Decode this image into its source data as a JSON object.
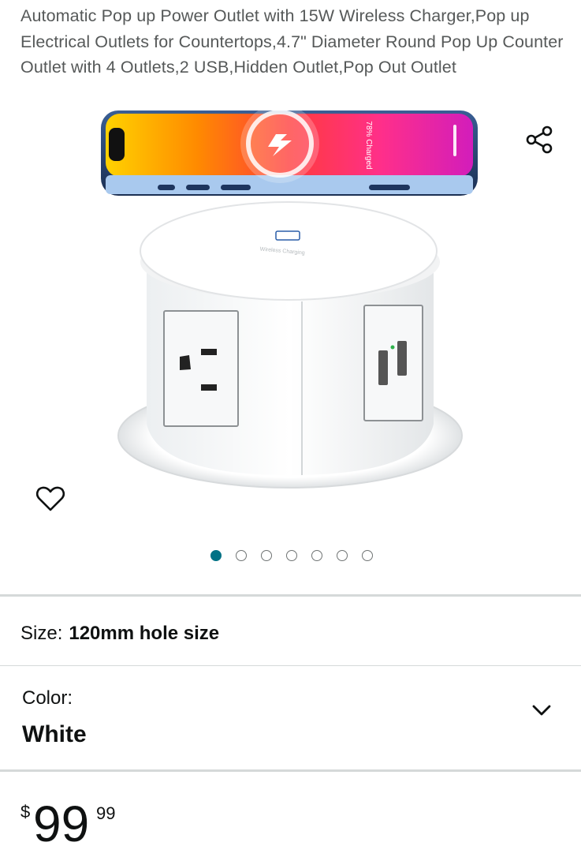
{
  "product": {
    "title": "Automatic Pop up Power Outlet with 15W Wireless Charger,Pop up Electrical Outlets for Countertops,4.7\" Diameter Round Pop Up Counter Outlet with 4 Outlets,2 USB,Hidden Outlet,Pop Out Outlet",
    "image_alt": "White pop-up power outlet with wireless charging top and a smartphone above it",
    "phone_screen_text": "78% Charged",
    "charger_top_text": "Wireless Charging"
  },
  "gallery": {
    "image_count": 7,
    "active_index": 0,
    "share_icon": "share-icon",
    "wishlist_icon": "heart-icon"
  },
  "variation": {
    "size_label": "Size:",
    "size_value": "120mm hole size",
    "color_label": "Color:",
    "color_value": "White",
    "dropdown_icon": "chevron-down-icon"
  },
  "price": {
    "symbol": "$",
    "whole": "99",
    "fraction": "99"
  },
  "colors": {
    "accent": "#007185",
    "text": "#0f1111",
    "secondary_text": "#565959",
    "divider": "#d5d9d9"
  }
}
